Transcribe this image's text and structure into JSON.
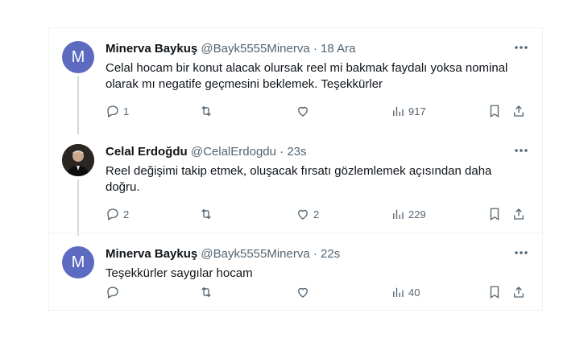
{
  "tweets": [
    {
      "avatar_letter": "M",
      "name": "Minerva Baykuş",
      "handle": "@Bayk5555Minerva",
      "separator": "·",
      "time": "18 Ara",
      "text": "Celal hocam bir konut alacak olursak reel mi bakmak faydalı yoksa nominal olarak mı negatife geçmesini beklemek. Teşekkürler",
      "replies": "1",
      "retweets": "",
      "likes": "",
      "views": "917"
    },
    {
      "avatar_letter": "",
      "name": "Celal Erdoğdu",
      "handle": "@CelalErdogdu",
      "separator": "·",
      "time": "23s",
      "text": "Reel değişimi takip etmek, oluşacak fırsatı gözlemlemek açısından daha doğru.",
      "replies": "2",
      "retweets": "",
      "likes": "2",
      "views": "229"
    },
    {
      "avatar_letter": "M",
      "name": "Minerva Baykuş",
      "handle": "@Bayk5555Minerva",
      "separator": "·",
      "time": "22s",
      "text": "Teşekkürler saygılar hocam",
      "replies": "",
      "retweets": "",
      "likes": "",
      "views": "40"
    }
  ],
  "icons": {
    "reply": "reply-icon",
    "retweet": "retweet-icon",
    "like": "heart-icon",
    "views": "views-icon",
    "bookmark": "bookmark-icon",
    "share": "share-icon",
    "more": "more-icon"
  },
  "colors": {
    "avatar_m": "#5c6bc0",
    "secondary_text": "#536471",
    "thread_line": "#cfd9de"
  }
}
